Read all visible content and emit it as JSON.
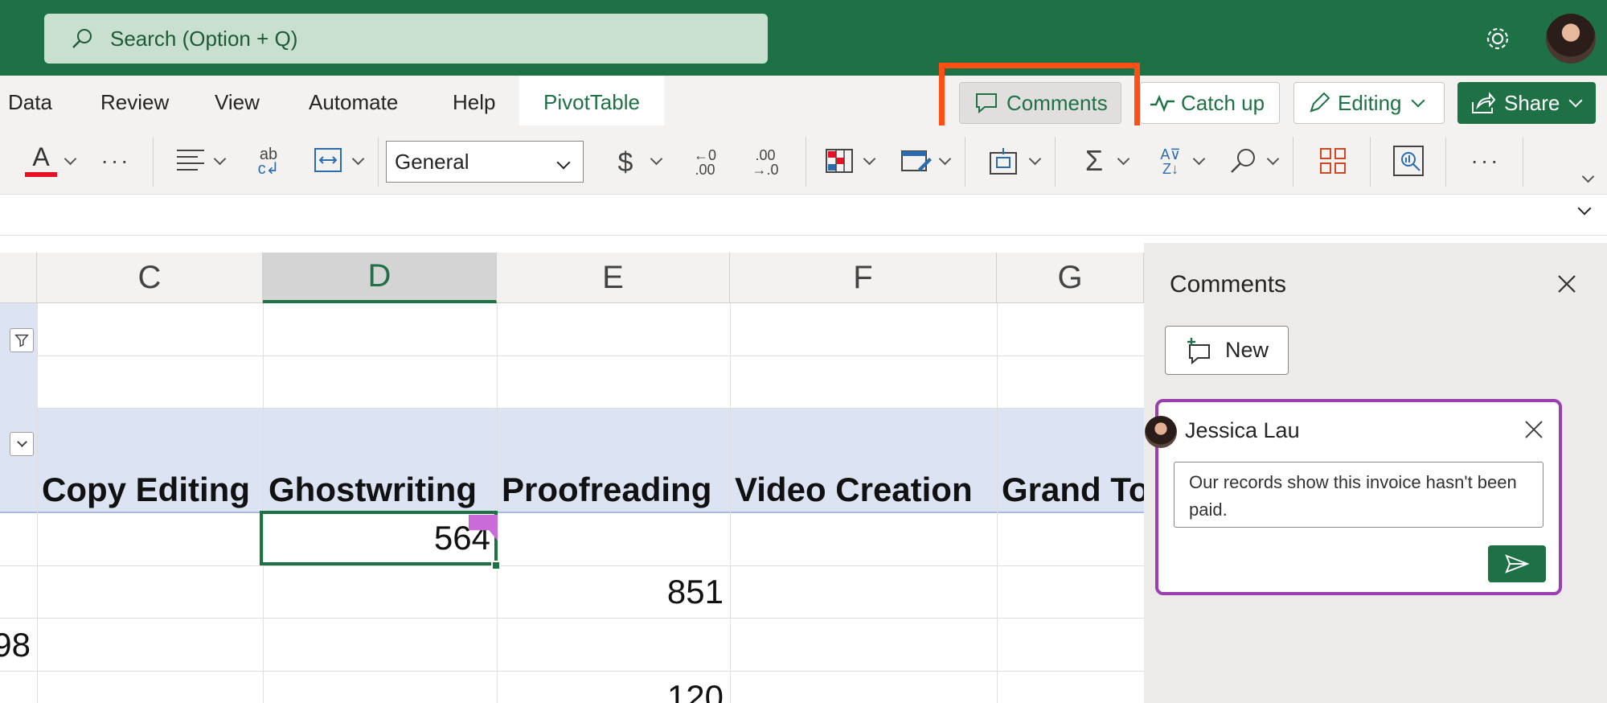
{
  "search": {
    "placeholder": "Search (Option + Q)"
  },
  "ribbon": {
    "tabs": [
      "Data",
      "Review",
      "View",
      "Automate",
      "Help",
      "PivotTable"
    ],
    "active_tab": "PivotTable",
    "buttons": {
      "comments": "Comments",
      "catch_up": "Catch up",
      "editing": "Editing",
      "share": "Share"
    },
    "number_format": "General",
    "currency_symbol": "$",
    "increase_decimal_label": "←0\n.00",
    "decrease_decimal_label": ".00\n→.0"
  },
  "grid": {
    "columns": [
      "C",
      "D",
      "E",
      "F",
      "G"
    ],
    "selected_column": "D",
    "pivot_headers": [
      "Copy Editing",
      "Ghostwriting",
      "Proofreading",
      "Video Creation",
      "Grand To"
    ],
    "cells": {
      "d_row1": "564",
      "e_row2": "851",
      "b_row3": "98",
      "e_row4": "120"
    }
  },
  "comments_pane": {
    "title": "Comments",
    "new_button": "New",
    "thread": {
      "author": "Jessica Lau",
      "text": "Our records show this invoice hasn't been paid."
    }
  },
  "colors": {
    "brand_green": "#1e7145",
    "highlight_orange": "#ff4f14",
    "comment_purple": "#9b3fb0",
    "pivot_band": "#dce3f3"
  },
  "icons": [
    "search-icon",
    "gear-icon",
    "comment-icon",
    "catch-up-icon",
    "pencil-icon",
    "share-icon",
    "close-icon",
    "new-comment-icon",
    "send-icon"
  ]
}
